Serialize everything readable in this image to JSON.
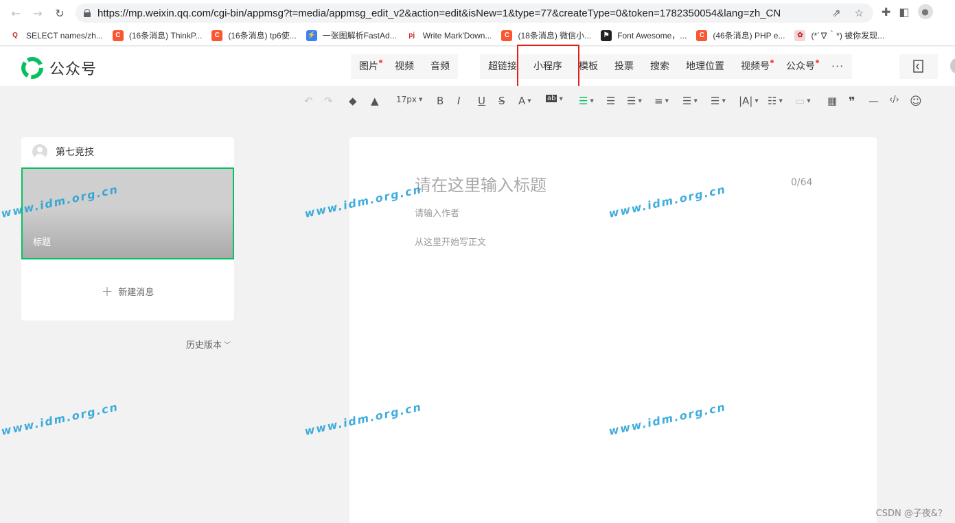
{
  "browser": {
    "url": "https://mp.weixin.qq.com/cgi-bin/appmsg?t=media/appmsg_edit_v2&action=edit&isNew=1&type=77&createType=0&token=1782350054&lang=zh_CN",
    "bookmarks": [
      {
        "label": "SELECT names/zh...",
        "icon": "q-icon",
        "color": "#ffffff"
      },
      {
        "label": "(16条消息) ThinkP...",
        "icon": "csdn-icon",
        "color": "#fc5531"
      },
      {
        "label": "(16条消息) tp6使...",
        "icon": "csdn-icon",
        "color": "#fc5531"
      },
      {
        "label": "一张图解析FastAd...",
        "icon": "bolt-icon",
        "color": "#3b82f6"
      },
      {
        "label": "Write Mark'Down...",
        "icon": "pj-icon",
        "color": "#ffffff"
      },
      {
        "label": "(18条消息) 微信小...",
        "icon": "csdn-icon",
        "color": "#fc5531"
      },
      {
        "label": "Font Awesome，...",
        "icon": "flag-icon",
        "color": "#222222"
      },
      {
        "label": "(46条消息) PHP e...",
        "icon": "csdn-icon",
        "color": "#fc5531"
      },
      {
        "label": "(*´∇｀*) 被你发现...",
        "icon": "rabbit-icon",
        "color": "#f4d4d4"
      }
    ]
  },
  "app": {
    "logo_text": "公众号",
    "brand_color": "#07c160",
    "media_items": [
      {
        "label": "图片",
        "dot": true
      },
      {
        "label": "视频",
        "dot": false
      },
      {
        "label": "音频",
        "dot": false
      }
    ],
    "insert_items": [
      {
        "label": "超链接",
        "dot": false
      },
      {
        "label": "小程序",
        "dot": false
      },
      {
        "label": "模板",
        "dot": false
      },
      {
        "label": "投票",
        "dot": false
      },
      {
        "label": "搜索",
        "dot": false
      },
      {
        "label": "地理位置",
        "dot": false
      },
      {
        "label": "视频号",
        "dot": true
      },
      {
        "label": "公众号",
        "dot": true
      }
    ],
    "more_label": "···"
  },
  "toolbar": {
    "font_size": "17px"
  },
  "left_panel": {
    "account_name": "第七竞技",
    "cover_title": "标题",
    "new_message": "新建消息",
    "history": "历史版本"
  },
  "editor": {
    "title_placeholder": "请在这里输入标题",
    "title_count": "0/64",
    "author_placeholder": "请输入作者",
    "body_placeholder": "从这里开始写正文"
  },
  "watermark": "www.idm.org.cn",
  "footer": {
    "csdn": "CSDN @子夜&？"
  }
}
